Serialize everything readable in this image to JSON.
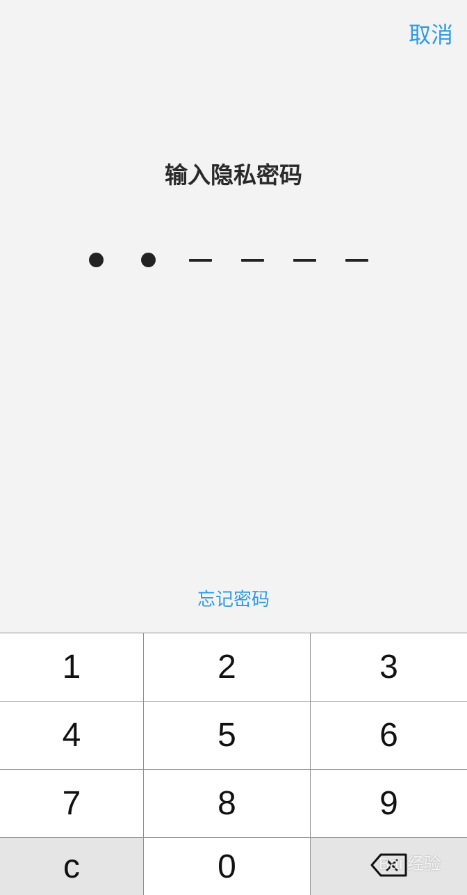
{
  "header": {
    "cancel_label": "取消"
  },
  "prompt": {
    "title": "输入隐私密码"
  },
  "pin": {
    "length": 6,
    "entered": 2
  },
  "links": {
    "forgot_label": "忘记密码"
  },
  "keypad": {
    "keys": [
      {
        "label": "1"
      },
      {
        "label": "2"
      },
      {
        "label": "3"
      },
      {
        "label": "4"
      },
      {
        "label": "5"
      },
      {
        "label": "6"
      },
      {
        "label": "7"
      },
      {
        "label": "8"
      },
      {
        "label": "9"
      },
      {
        "label": "c"
      },
      {
        "label": "0"
      },
      {
        "label": "",
        "icon": "backspace-icon"
      }
    ]
  },
  "watermark": {
    "text": "Bai 经验"
  },
  "colors": {
    "accent": "#2f9be8",
    "background": "#f3f3f3",
    "key_bg": "#ffffff",
    "special_key_bg": "#e5e5e5"
  }
}
